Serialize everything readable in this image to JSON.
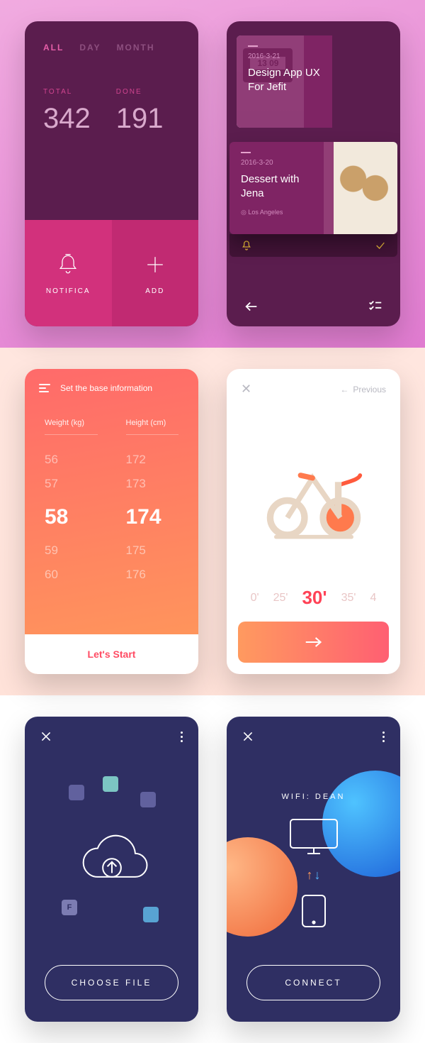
{
  "card1": {
    "tabs": {
      "all": "ALL",
      "day": "DAY",
      "month": "MONTH"
    },
    "total_label": "TOTAL",
    "total_value": "342",
    "done_label": "DONE",
    "done_value": "191",
    "notify_label": "NOTIFICA",
    "add_label": "ADD"
  },
  "card2": {
    "tasks": [
      {
        "date": "2016-3-21",
        "title": "Design App UX For Jefit",
        "clock": "13 09"
      },
      {
        "date": "2016-3-20",
        "title": "Dessert with Jena",
        "location": "Los Angeles"
      }
    ]
  },
  "card3": {
    "title": "Set the base information",
    "weight_label": "Weight (kg)",
    "height_label": "Height (cm)",
    "weights": [
      "56",
      "57",
      "58",
      "59",
      "60"
    ],
    "heights": [
      "172",
      "173",
      "174",
      "175",
      "176"
    ],
    "weight_selected": "58",
    "height_selected": "174",
    "cta": "Let's Start"
  },
  "card4": {
    "previous": "Previous",
    "durations": [
      "0'",
      "25'",
      "30'",
      "35'",
      "4"
    ],
    "selected": "30'"
  },
  "card5": {
    "file_tile_letter": "F",
    "cta": "CHOOSE FILE"
  },
  "card6": {
    "wifi": "WIFI: DEAN",
    "cta": "CONNECT"
  }
}
